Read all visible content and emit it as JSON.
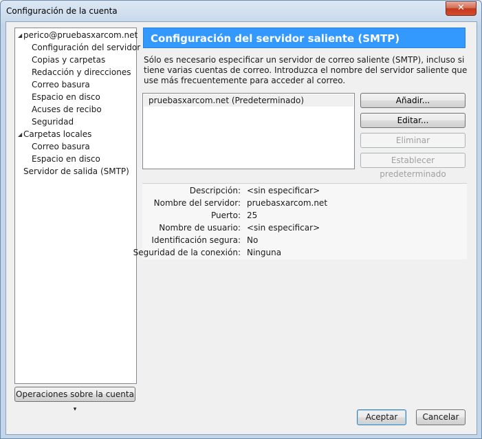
{
  "window": {
    "title": "Configuración de la cuenta",
    "close_glyph": "✕"
  },
  "tree": {
    "items": [
      {
        "label": "perico@pruebasxarcom.net",
        "expander": "◢"
      },
      {
        "label": "Configuración del servidor"
      },
      {
        "label": "Copias y carpetas"
      },
      {
        "label": "Redacción y direcciones"
      },
      {
        "label": "Correo basura"
      },
      {
        "label": "Espacio en disco"
      },
      {
        "label": "Acuses de recibo"
      },
      {
        "label": "Seguridad"
      },
      {
        "label": "Carpetas locales",
        "expander": "◢"
      },
      {
        "label": "Correo basura"
      },
      {
        "label": "Espacio en disco"
      },
      {
        "label": "Servidor de salida (SMTP)"
      }
    ],
    "account_ops_label": "Operaciones sobre la cuenta",
    "account_ops_arrow": "▾"
  },
  "panel": {
    "title": "Configuración del servidor saliente (SMTP)",
    "description": "Sólo es necesario especificar un servidor de correo saliente (SMTP), incluso si tiene varias cuentas de correo. Introduzca el nombre del servidor saliente que use más frecuentemente para acceder al correo.",
    "servers": [
      "pruebasxarcom.net (Predeterminado)"
    ],
    "buttons": {
      "add": "Añadir...",
      "edit": "Editar...",
      "delete": "Eliminar",
      "set_default": "Establecer predeterminado"
    },
    "details": [
      {
        "label": "Descripción:",
        "value": "<sin especificar>"
      },
      {
        "label": "Nombre del servidor:",
        "value": "pruebasxarcom.net"
      },
      {
        "label": "Puerto:",
        "value": "25"
      },
      {
        "label": "Nombre de usuario:",
        "value": "<sin especificar>"
      },
      {
        "label": "Identificación segura:",
        "value": "No"
      },
      {
        "label": "Seguridad de la conexión:",
        "value": "Ninguna"
      }
    ]
  },
  "footer": {
    "accept": "Aceptar",
    "cancel": "Cancelar"
  },
  "colors": {
    "header_bg": "#3399ff",
    "selected_row_bg": "#f0f0f0"
  }
}
